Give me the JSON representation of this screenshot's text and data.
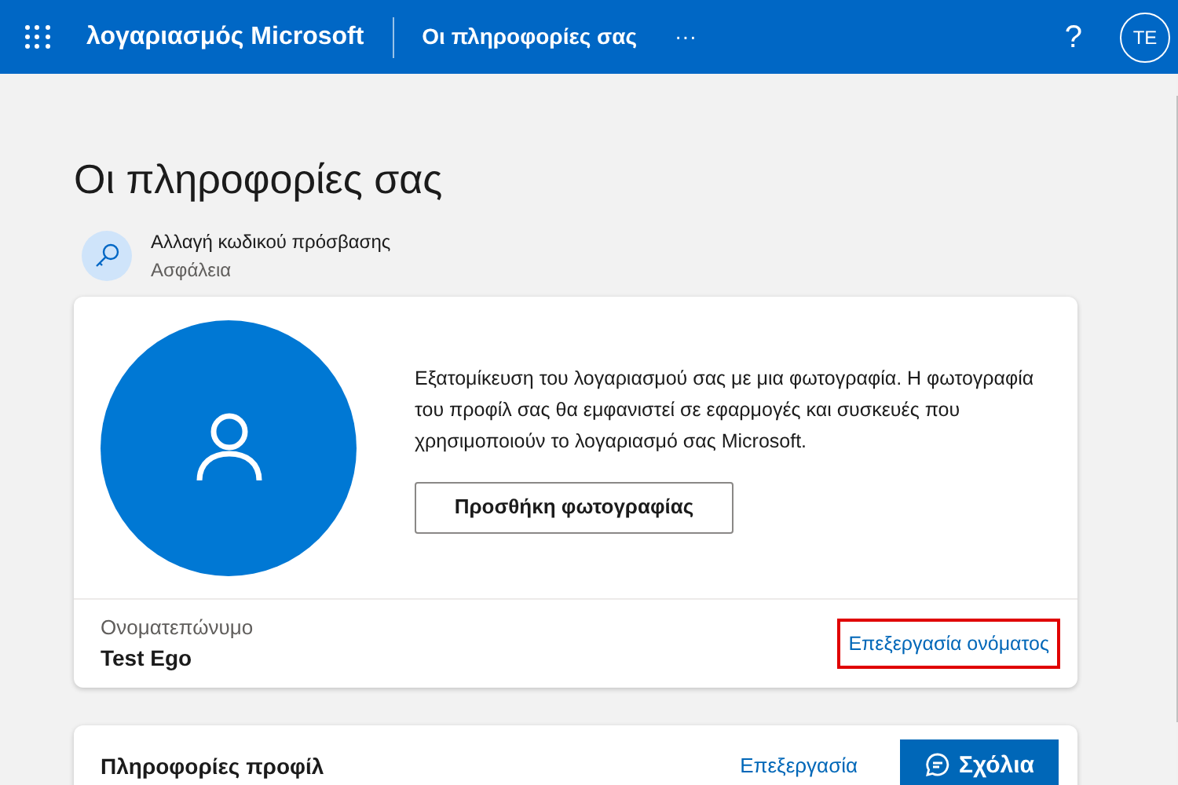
{
  "header": {
    "brand": "λογαριασμός Microsoft",
    "section": "Οι πληροφορίες σας",
    "more": "···",
    "help": "?",
    "avatar": "TE"
  },
  "page_title": "Οι πληροφορίες σας",
  "quick_link": {
    "title": "Αλλαγή κωδικού πρόσβασης",
    "subtitle": "Ασφάλεια"
  },
  "photo_card": {
    "description": "Εξατομίκευση του λογαριασμού σας με μια φωτογραφία. Η φωτογραφία του προφίλ σας θα εμφανιστεί σε εφαρμογές και συσκευές που χρησιμοποιούν το λογαριασμό σας Microsoft.",
    "button": "Προσθήκη φωτογραφίας",
    "name_label": "Ονοματεπώνυμο",
    "name_value": "Test Ego",
    "edit_link": "Επεξεργασία ονόματος",
    "edit_link_highlighted": true
  },
  "profile_card": {
    "title": "Πληροφορίες προφίλ",
    "edit_link": "Επεξεργασία"
  },
  "feedback_button": "Σχόλια"
}
